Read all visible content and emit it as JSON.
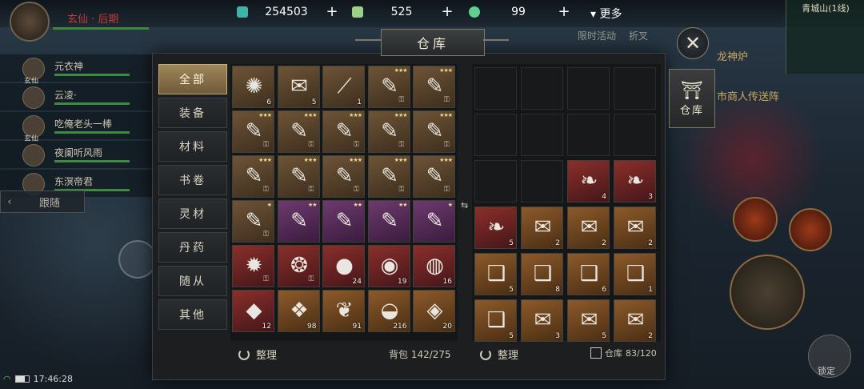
{
  "hud": {
    "player_title": "玄仙 · 后期",
    "currencies": [
      {
        "value": "254503",
        "color": "#3fb3a6"
      },
      {
        "value": "525",
        "color": "#9ccf8a"
      },
      {
        "value": "99",
        "color": "#5fcf8f"
      }
    ],
    "more_label": "更多",
    "world_labels": [
      "限时活动",
      "折叉"
    ],
    "merchant_text": "市商人传送阵",
    "bag_text": "龙神炉",
    "minimap_title": "青城山(1线)",
    "lock_label": "锁定",
    "clock": "17:46:28"
  },
  "party": {
    "members": [
      {
        "name": "元衣神",
        "role": "玄仙"
      },
      {
        "name": "云凌·",
        "role": ""
      },
      {
        "name": "吃俺老头一棒",
        "role": "玄仙"
      },
      {
        "name": "夜阑听风雨",
        "role": ""
      },
      {
        "name": "东溟帝君",
        "role": ""
      }
    ],
    "follow_label": "跟随"
  },
  "panel": {
    "title": "仓库",
    "side_tab_label": "仓库",
    "categories": [
      "全部",
      "装备",
      "材料",
      "书卷",
      "灵材",
      "丹药",
      "随从",
      "其他"
    ],
    "sort_label": "整理",
    "bag_label": "背包",
    "bag_count": "142/275",
    "warehouse_label": "仓库",
    "warehouse_count": "83/120"
  },
  "bag_slots": [
    {
      "q": "brown",
      "icon": "✺",
      "count": "6",
      "stars": "",
      "lock": false
    },
    {
      "q": "brown",
      "icon": "✉",
      "count": "5",
      "stars": "",
      "lock": false
    },
    {
      "q": "brown",
      "icon": "⟋",
      "count": "1",
      "stars": "",
      "lock": false
    },
    {
      "q": "brown",
      "icon": "✎",
      "count": "",
      "stars": "★★★",
      "lock": true
    },
    {
      "q": "brown",
      "icon": "✎",
      "count": "",
      "stars": "★★★",
      "lock": true
    },
    {
      "q": "brown",
      "icon": "✎",
      "count": "",
      "stars": "★★★",
      "lock": true
    },
    {
      "q": "brown",
      "icon": "✎",
      "count": "",
      "stars": "★★★",
      "lock": true
    },
    {
      "q": "brown",
      "icon": "✎",
      "count": "",
      "stars": "★★★",
      "lock": true
    },
    {
      "q": "brown",
      "icon": "✎",
      "count": "",
      "stars": "★★★",
      "lock": true
    },
    {
      "q": "brown",
      "icon": "✎",
      "count": "",
      "stars": "★★★",
      "lock": true
    },
    {
      "q": "brown",
      "icon": "✎",
      "count": "",
      "stars": "★★★",
      "lock": true
    },
    {
      "q": "brown",
      "icon": "✎",
      "count": "",
      "stars": "★★★",
      "lock": true
    },
    {
      "q": "brown",
      "icon": "✎",
      "count": "",
      "stars": "★★★",
      "lock": true
    },
    {
      "q": "brown",
      "icon": "✎",
      "count": "",
      "stars": "★★★",
      "lock": true
    },
    {
      "q": "brown",
      "icon": "✎",
      "count": "",
      "stars": "★★★",
      "lock": true
    },
    {
      "q": "brown",
      "icon": "✎",
      "count": "",
      "stars": "★",
      "lock": true
    },
    {
      "q": "purple",
      "icon": "✎",
      "count": "",
      "stars": "★★",
      "lock": false
    },
    {
      "q": "purple",
      "icon": "✎",
      "count": "",
      "stars": "★★",
      "lock": false
    },
    {
      "q": "purple",
      "icon": "✎",
      "count": "",
      "stars": "★★",
      "lock": false
    },
    {
      "q": "purple",
      "icon": "✎",
      "count": "",
      "stars": "★",
      "lock": false
    },
    {
      "q": "red",
      "icon": "✹",
      "count": "",
      "stars": "",
      "lock": true
    },
    {
      "q": "red",
      "icon": "❂",
      "count": "",
      "stars": "",
      "lock": true
    },
    {
      "q": "red",
      "icon": "●",
      "count": "24",
      "stars": "",
      "lock": false
    },
    {
      "q": "red",
      "icon": "◉",
      "count": "19",
      "stars": "",
      "lock": false
    },
    {
      "q": "red",
      "icon": "◍",
      "count": "16",
      "stars": "",
      "lock": false
    },
    {
      "q": "red",
      "icon": "◆",
      "count": "12",
      "stars": "",
      "lock": false
    },
    {
      "q": "orange",
      "icon": "❖",
      "count": "98",
      "stars": "",
      "lock": false
    },
    {
      "q": "orange",
      "icon": "❦",
      "count": "91",
      "stars": "",
      "lock": false
    },
    {
      "q": "orange",
      "icon": "◒",
      "count": "216",
      "stars": "",
      "lock": false
    },
    {
      "q": "orange",
      "icon": "◈",
      "count": "20",
      "stars": "",
      "lock": false
    }
  ],
  "warehouse_slots": [
    {
      "q": "empty",
      "icon": "",
      "count": ""
    },
    {
      "q": "empty",
      "icon": "",
      "count": ""
    },
    {
      "q": "empty",
      "icon": "",
      "count": ""
    },
    {
      "q": "empty",
      "icon": "",
      "count": ""
    },
    {
      "q": "empty",
      "icon": "",
      "count": ""
    },
    {
      "q": "empty",
      "icon": "",
      "count": ""
    },
    {
      "q": "empty",
      "icon": "",
      "count": ""
    },
    {
      "q": "empty",
      "icon": "",
      "count": ""
    },
    {
      "q": "empty",
      "icon": "",
      "count": ""
    },
    {
      "q": "empty",
      "icon": "",
      "count": ""
    },
    {
      "q": "red",
      "icon": "❧",
      "count": "4"
    },
    {
      "q": "red",
      "icon": "❧",
      "count": "3"
    },
    {
      "q": "red",
      "icon": "❧",
      "count": "5"
    },
    {
      "q": "orange",
      "icon": "✉",
      "count": "2"
    },
    {
      "q": "orange",
      "icon": "✉",
      "count": "2"
    },
    {
      "q": "orange",
      "icon": "✉",
      "count": "2"
    },
    {
      "q": "orange",
      "icon": "❑",
      "count": "5"
    },
    {
      "q": "orange",
      "icon": "❑",
      "count": "8"
    },
    {
      "q": "orange",
      "icon": "❑",
      "count": "6"
    },
    {
      "q": "orange",
      "icon": "❑",
      "count": "1"
    },
    {
      "q": "orange",
      "icon": "❑",
      "count": "5"
    },
    {
      "q": "orange",
      "icon": "✉",
      "count": "3"
    },
    {
      "q": "orange",
      "icon": "✉",
      "count": "5"
    },
    {
      "q": "orange",
      "icon": "✉",
      "count": "2"
    }
  ]
}
